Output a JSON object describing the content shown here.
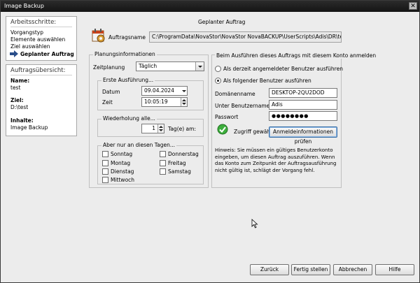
{
  "window": {
    "title": "Image Backup"
  },
  "sidebar": {
    "steps_title": "Arbeitsschritte:",
    "steps": [
      {
        "label": "Vorgangstyp"
      },
      {
        "label": "Elemente auswählen"
      },
      {
        "label": "Ziel auswählen"
      },
      {
        "label": "Geplanter Auftrag"
      }
    ],
    "overview_title": "Auftragsübersicht:",
    "overview": {
      "name_label": "Name:",
      "name_value": "test",
      "target_label": "Ziel:",
      "target_value": "D:\\test",
      "content_label": "Inhalte:",
      "content_value": "Image Backup"
    }
  },
  "main": {
    "heading": "Geplanter Auftrag",
    "job_name_label": "Auftragsname",
    "job_name_value": "C:\\ProgramData\\NovaStor\\NovaStor NovaBACKUP\\UserScripts\\Adis\\DR\\test-Vollständig...",
    "planning": {
      "title": "Planungsinformationen",
      "schedule_label": "Zeitplanung",
      "schedule_value": "Täglich",
      "first_run": {
        "title": "Erste Ausführung...",
        "date_label": "Datum",
        "date_value": "09.04.2024",
        "time_label": "Zeit",
        "time_value": "10:05:19"
      },
      "repeat": {
        "title": "Wiederholung alle...",
        "value": "1",
        "unit": "Tag(e) am:"
      },
      "days": {
        "title": "Aber nur an diesen Tagen...",
        "items": [
          {
            "label": "Sonntag"
          },
          {
            "label": "Donnerstag"
          },
          {
            "label": "Montag"
          },
          {
            "label": "Freitag"
          },
          {
            "label": "Dienstag"
          },
          {
            "label": "Samstag"
          },
          {
            "label": "Mittwoch"
          }
        ]
      }
    },
    "account": {
      "title": "Beim Ausführen dieses Auftrags mit diesem Konto anmelden",
      "radio_current": "Als derzeit angemeldeter Benutzer ausführen",
      "radio_other": "Als folgender Benutzer ausführen",
      "domain_label": "Domänenname",
      "domain_value": "DESKTOP-2QU2DOD",
      "user_label": "Unter Benutzernamen",
      "user_value": "Adis",
      "password_label": "Passwort",
      "password_value": "●●●●●●●●",
      "access_text": "Zugriff gewährt",
      "check_button": "Anmeldeinformationen prüfen",
      "hint": "Hinweis: Sie müssen ein gültiges Benutzerkonto eingeben, um diesen Auftrag auszuführen. Wenn das Konto zum Zeitpunkt der Auftragsausführung nicht gültig ist, schlägt der Vorgang fehl."
    }
  },
  "footer": {
    "back": "Zurück",
    "finish": "Fertig stellen",
    "cancel": "Abbrechen",
    "help": "Hilfe"
  }
}
